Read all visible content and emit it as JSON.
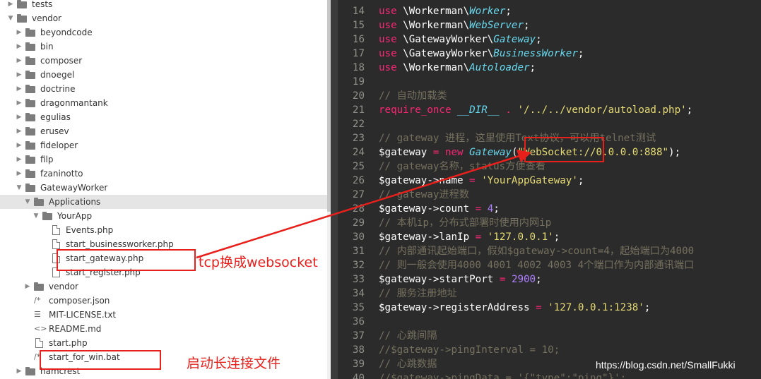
{
  "file_tree": {
    "items": [
      {
        "label": "tests",
        "kind": "folder",
        "state": "collapsed"
      },
      {
        "label": "vendor",
        "kind": "folder",
        "state": "expanded"
      },
      {
        "label": "beyondcode",
        "kind": "folder",
        "state": "collapsed"
      },
      {
        "label": "bin",
        "kind": "folder",
        "state": "collapsed"
      },
      {
        "label": "composer",
        "kind": "folder",
        "state": "collapsed"
      },
      {
        "label": "dnoegel",
        "kind": "folder",
        "state": "collapsed"
      },
      {
        "label": "doctrine",
        "kind": "folder",
        "state": "collapsed"
      },
      {
        "label": "dragonmantank",
        "kind": "folder",
        "state": "collapsed"
      },
      {
        "label": "egulias",
        "kind": "folder",
        "state": "collapsed"
      },
      {
        "label": "erusev",
        "kind": "folder",
        "state": "collapsed"
      },
      {
        "label": "fideloper",
        "kind": "folder",
        "state": "collapsed"
      },
      {
        "label": "filp",
        "kind": "folder",
        "state": "collapsed"
      },
      {
        "label": "fzaninotto",
        "kind": "folder",
        "state": "collapsed"
      },
      {
        "label": "GatewayWorker",
        "kind": "folder",
        "state": "expanded"
      },
      {
        "label": "Applications",
        "kind": "folder",
        "state": "expanded",
        "selected": true
      },
      {
        "label": "YourApp",
        "kind": "folder",
        "state": "expanded"
      },
      {
        "label": "Events.php",
        "kind": "file",
        "icon": "file-icon"
      },
      {
        "label": "start_businessworker.php",
        "kind": "file",
        "icon": "file-icon"
      },
      {
        "label": "start_gateway.php",
        "kind": "file",
        "icon": "file-icon"
      },
      {
        "label": "start_register.php",
        "kind": "file",
        "icon": "file-icon"
      },
      {
        "label": "vendor",
        "kind": "folder",
        "state": "collapsed"
      },
      {
        "label": "composer.json",
        "kind": "file",
        "icon": "json-icon"
      },
      {
        "label": "MIT-LICENSE.txt",
        "kind": "file",
        "icon": "text-lines-icon"
      },
      {
        "label": "README.md",
        "kind": "file",
        "icon": "code-brackets-icon"
      },
      {
        "label": "start.php",
        "kind": "file",
        "icon": "file-icon"
      },
      {
        "label": "start_for_win.bat",
        "kind": "file",
        "icon": "comment-icon"
      },
      {
        "label": "hamcrest",
        "kind": "folder",
        "state": "collapsed"
      }
    ]
  },
  "editor": {
    "lines": [
      {
        "n": "14",
        "tokens": [
          [
            "kw",
            "use"
          ],
          [
            "var",
            " \\Workerman\\"
          ],
          [
            "cls",
            "Worker"
          ],
          [
            "var",
            ";"
          ]
        ]
      },
      {
        "n": "15",
        "tokens": [
          [
            "kw",
            "use"
          ],
          [
            "var",
            " \\Workerman\\"
          ],
          [
            "cls",
            "WebServer"
          ],
          [
            "var",
            ";"
          ]
        ]
      },
      {
        "n": "16",
        "tokens": [
          [
            "kw",
            "use"
          ],
          [
            "var",
            " \\GatewayWorker\\"
          ],
          [
            "cls",
            "Gateway"
          ],
          [
            "var",
            ";"
          ]
        ]
      },
      {
        "n": "17",
        "tokens": [
          [
            "kw",
            "use"
          ],
          [
            "var",
            " \\GatewayWorker\\"
          ],
          [
            "cls",
            "BusinessWorker"
          ],
          [
            "var",
            ";"
          ]
        ]
      },
      {
        "n": "18",
        "tokens": [
          [
            "kw",
            "use"
          ],
          [
            "var",
            " \\Workerman\\"
          ],
          [
            "cls",
            "Autoloader"
          ],
          [
            "var",
            ";"
          ]
        ]
      },
      {
        "n": "19",
        "tokens": []
      },
      {
        "n": "20",
        "tokens": [
          [
            "cm",
            "// 自动加载类"
          ]
        ]
      },
      {
        "n": "21",
        "tokens": [
          [
            "kw",
            "require_once"
          ],
          [
            "var",
            " "
          ],
          [
            "cls",
            "__DIR__"
          ],
          [
            "var",
            " "
          ],
          [
            "op",
            "."
          ],
          [
            "var",
            " "
          ],
          [
            "str",
            "'/../../vendor/autoload.php'"
          ],
          [
            "var",
            ";"
          ]
        ]
      },
      {
        "n": "22",
        "tokens": []
      },
      {
        "n": "23",
        "tokens": [
          [
            "cm",
            "// gateway 进程，这里使用Text协议，可以用telnet测试"
          ]
        ]
      },
      {
        "n": "24",
        "tokens": [
          [
            "var",
            "$gateway "
          ],
          [
            "op",
            "="
          ],
          [
            "var",
            " "
          ],
          [
            "kw",
            "new"
          ],
          [
            "var",
            " "
          ],
          [
            "cls",
            "Gateway"
          ],
          [
            "var",
            "("
          ],
          [
            "str",
            "\"WebSocket://0.0.0.0:888\""
          ],
          [
            "var",
            ");"
          ]
        ]
      },
      {
        "n": "25",
        "tokens": [
          [
            "cm",
            "// gateway名称，status方便查看"
          ]
        ]
      },
      {
        "n": "26",
        "tokens": [
          [
            "var",
            "$gateway->name "
          ],
          [
            "op",
            "="
          ],
          [
            "var",
            " "
          ],
          [
            "str",
            "'YourAppGateway'"
          ],
          [
            "var",
            ";"
          ]
        ]
      },
      {
        "n": "27",
        "tokens": [
          [
            "cm",
            "// gateway进程数"
          ]
        ]
      },
      {
        "n": "28",
        "tokens": [
          [
            "var",
            "$gateway->count "
          ],
          [
            "op",
            "="
          ],
          [
            "var",
            " "
          ],
          [
            "num",
            "4"
          ],
          [
            "var",
            ";"
          ]
        ]
      },
      {
        "n": "29",
        "tokens": [
          [
            "cm",
            "// 本机ip，分布式部署时使用内网ip"
          ]
        ]
      },
      {
        "n": "30",
        "tokens": [
          [
            "var",
            "$gateway->lanIp "
          ],
          [
            "op",
            "="
          ],
          [
            "var",
            " "
          ],
          [
            "str",
            "'127.0.0.1'"
          ],
          [
            "var",
            ";"
          ]
        ]
      },
      {
        "n": "31",
        "tokens": [
          [
            "cm",
            "// 内部通讯起始端口，假如$gateway->count=4，起始端口为4000"
          ]
        ]
      },
      {
        "n": "32",
        "tokens": [
          [
            "cm",
            "// 则一般会使用4000 4001 4002 4003 4个端口作为内部通讯端口"
          ]
        ]
      },
      {
        "n": "33",
        "tokens": [
          [
            "var",
            "$gateway->startPort "
          ],
          [
            "op",
            "="
          ],
          [
            "var",
            " "
          ],
          [
            "num",
            "2900"
          ],
          [
            "var",
            ";"
          ]
        ]
      },
      {
        "n": "34",
        "tokens": [
          [
            "cm",
            "// 服务注册地址"
          ]
        ]
      },
      {
        "n": "35",
        "tokens": [
          [
            "var",
            "$gateway->registerAddress "
          ],
          [
            "op",
            "="
          ],
          [
            "var",
            " "
          ],
          [
            "str",
            "'127.0.0.1:1238'"
          ],
          [
            "var",
            ";"
          ]
        ]
      },
      {
        "n": "36",
        "tokens": []
      },
      {
        "n": "37",
        "tokens": [
          [
            "cm",
            "// 心跳间隔"
          ]
        ]
      },
      {
        "n": "38",
        "tokens": [
          [
            "cm",
            "//$gateway->pingInterval = 10;"
          ]
        ]
      },
      {
        "n": "39",
        "tokens": [
          [
            "cm",
            "// 心跳数据"
          ]
        ]
      },
      {
        "n": "40",
        "tokens": [
          [
            "cm",
            "//$gateway->pingData = '{\"type\":\"ping\"}';"
          ]
        ]
      }
    ]
  },
  "annotations": {
    "tcp_label": "tcp换成websocket",
    "startup_label": "启动长连接文件",
    "watermark": "https://blog.csdn.net/SmallFukki"
  },
  "colors": {
    "annotation_red": "#e8201b",
    "editor_bg": "#2b2b2b",
    "keyword": "#f92672",
    "class_name": "#66d9ef",
    "string": "#e6db74",
    "number": "#ae81ff",
    "comment": "#75715e"
  }
}
